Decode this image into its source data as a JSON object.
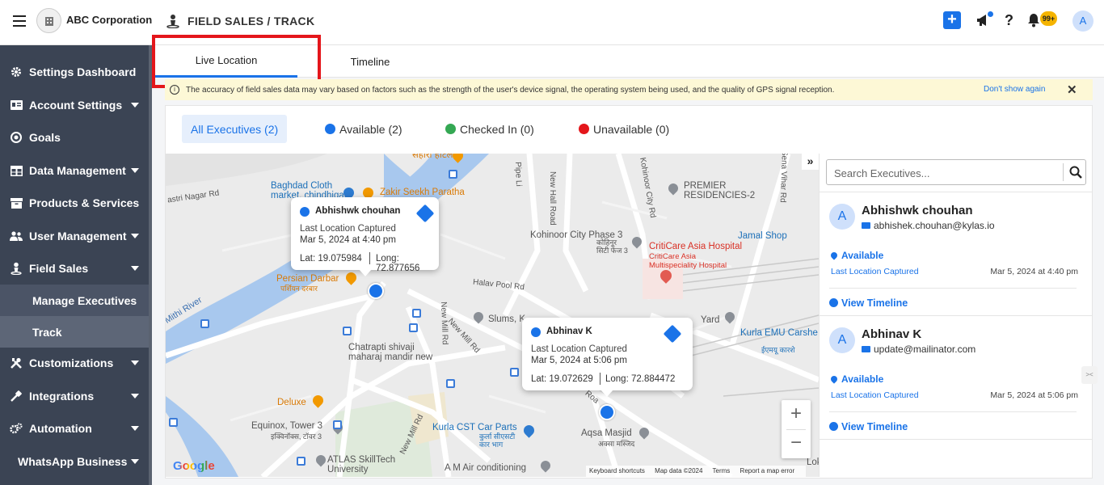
{
  "header": {
    "org_name": "ABC Corporation",
    "breadcrumb": "FIELD SALES / TRACK",
    "notification_badge": "99+",
    "user_initial": "A"
  },
  "sidebar": {
    "items": [
      {
        "label": "Settings Dashboard",
        "icon": "gear-icon",
        "has_caret": false
      },
      {
        "label": "Account Settings",
        "icon": "id-card-icon",
        "has_caret": true
      },
      {
        "label": "Goals",
        "icon": "target-icon",
        "has_caret": false
      },
      {
        "label": "Data Management",
        "icon": "table-icon",
        "has_caret": true
      },
      {
        "label": "Products & Services",
        "icon": "box-icon",
        "has_caret": false
      },
      {
        "label": "User Management",
        "icon": "users-icon",
        "has_caret": true
      },
      {
        "label": "Field Sales",
        "icon": "person-pin-icon",
        "has_caret": true
      },
      {
        "label": "Customizations",
        "icon": "tools-icon",
        "has_caret": true
      },
      {
        "label": "Integrations",
        "icon": "plug-icon",
        "has_caret": true
      },
      {
        "label": "Automation",
        "icon": "cogs-icon",
        "has_caret": true
      },
      {
        "label": "WhatsApp Business",
        "icon": "",
        "has_caret": true
      }
    ],
    "sub_items": [
      "Manage Executives",
      "Track"
    ],
    "active_sub": "Track"
  },
  "tabs": [
    "Live Location",
    "Timeline"
  ],
  "notice": {
    "text": "The accuracy of field sales data may vary based on factors such as the strength of the user's device signal, the operating system being used, and the quality of GPS signal reception.",
    "dismiss": "Don't show again"
  },
  "filters": {
    "all": "All Executives (2)",
    "available": "Available (2)",
    "checked_in": "Checked In (0)",
    "unavailable": "Unavailable (0)"
  },
  "status_colors": {
    "available": "#1a73e8",
    "checked_in": "#34a853",
    "unavailable": "#e4161b"
  },
  "map": {
    "places": {
      "sahara": "सहारा हॉटल",
      "baghdad": "Baghdad Cloth\nmarket, chindhiqalli",
      "zakir": "Zakir Seekh Paratha",
      "premier": "PREMIER\nRESIDENCIES-2",
      "kohinoor": "Kohinoor City Phase 3",
      "kohinoor_hi": "कोहिनूर\nसिटी फेज 3",
      "criticare": "CritiCare Asia Hospital",
      "criticare_sub": "CritiCare Asia\nMultispeciality Hospital",
      "jamal": "Jamal Shop",
      "persian": "Persian Darbar",
      "persian_hi": "पर्शियन दरबार",
      "slums": "Slums, K",
      "chatrapti": "Chatrapti shivaji\nmaharaj mandir new",
      "yard": "Yard",
      "kurla_emu": "Kurla EMU Carshe",
      "kurla_emu_hi": "ईएमयू कारशे",
      "deluxe": "Deluxe",
      "equinox": "Equinox, Tower 3",
      "equinox_hi": "इक्विनॉक्स, टॉवर 3",
      "kurla_cst": "Kurla CST Car Parts",
      "kurla_cst_hi": "कुर्ला सीएसटी\nकार भाग",
      "aqsa": "Aqsa Masjid",
      "aqsa_hi": "अक्सा मस्जिद",
      "atlas": "ATLAS SkillTech\nUniversity",
      "am_air": "A M Air conditioning",
      "lok": "Lok"
    },
    "roads": {
      "nagar": "astri Nagar Rd",
      "pipe": "Pipe Li",
      "new_hall": "New Hall Road",
      "kohinoor_city": "Kohinoor City Rd",
      "sena": "Sena Vihar Rd",
      "mithi": "Mithi River",
      "halav": "Halav Pool Rd",
      "new_mill_1": "New Mill Rd",
      "new_mill_2": "New Mill Rd",
      "new_mill_3": "New Mill Rd",
      "roa": "Roa"
    },
    "popups": [
      {
        "name": "Abhishwk chouhan",
        "label": "Last Location Captured",
        "time": "Mar 5, 2024 at 4:40 pm",
        "lat": "Lat: 19.075984",
        "lng": "Long: 72.877656"
      },
      {
        "name": "Abhinav K",
        "label": "Last Location Captured",
        "time": "Mar 5, 2024 at 5:06 pm",
        "lat": "Lat: 19.072629",
        "lng": "Long: 72.884472"
      }
    ],
    "google": "Google",
    "attribution": [
      "Keyboard shortcuts",
      "Map data ©2024",
      "Terms",
      "Report a map error"
    ]
  },
  "search": {
    "placeholder": "Search Executives..."
  },
  "executives": [
    {
      "initial": "A",
      "name": "Abhishwk chouhan",
      "email": "abhishek.chouhan@kylas.io",
      "status": "Available",
      "last_label": "Last Location Captured",
      "time": "Mar 5, 2024 at 4:40 pm",
      "view": "View Timeline"
    },
    {
      "initial": "A",
      "name": "Abhinav K",
      "email": "update@mailinator.com",
      "status": "Available",
      "last_label": "Last Location Captured",
      "time": "Mar 5, 2024 at 5:06 pm",
      "view": "View Timeline"
    }
  ]
}
